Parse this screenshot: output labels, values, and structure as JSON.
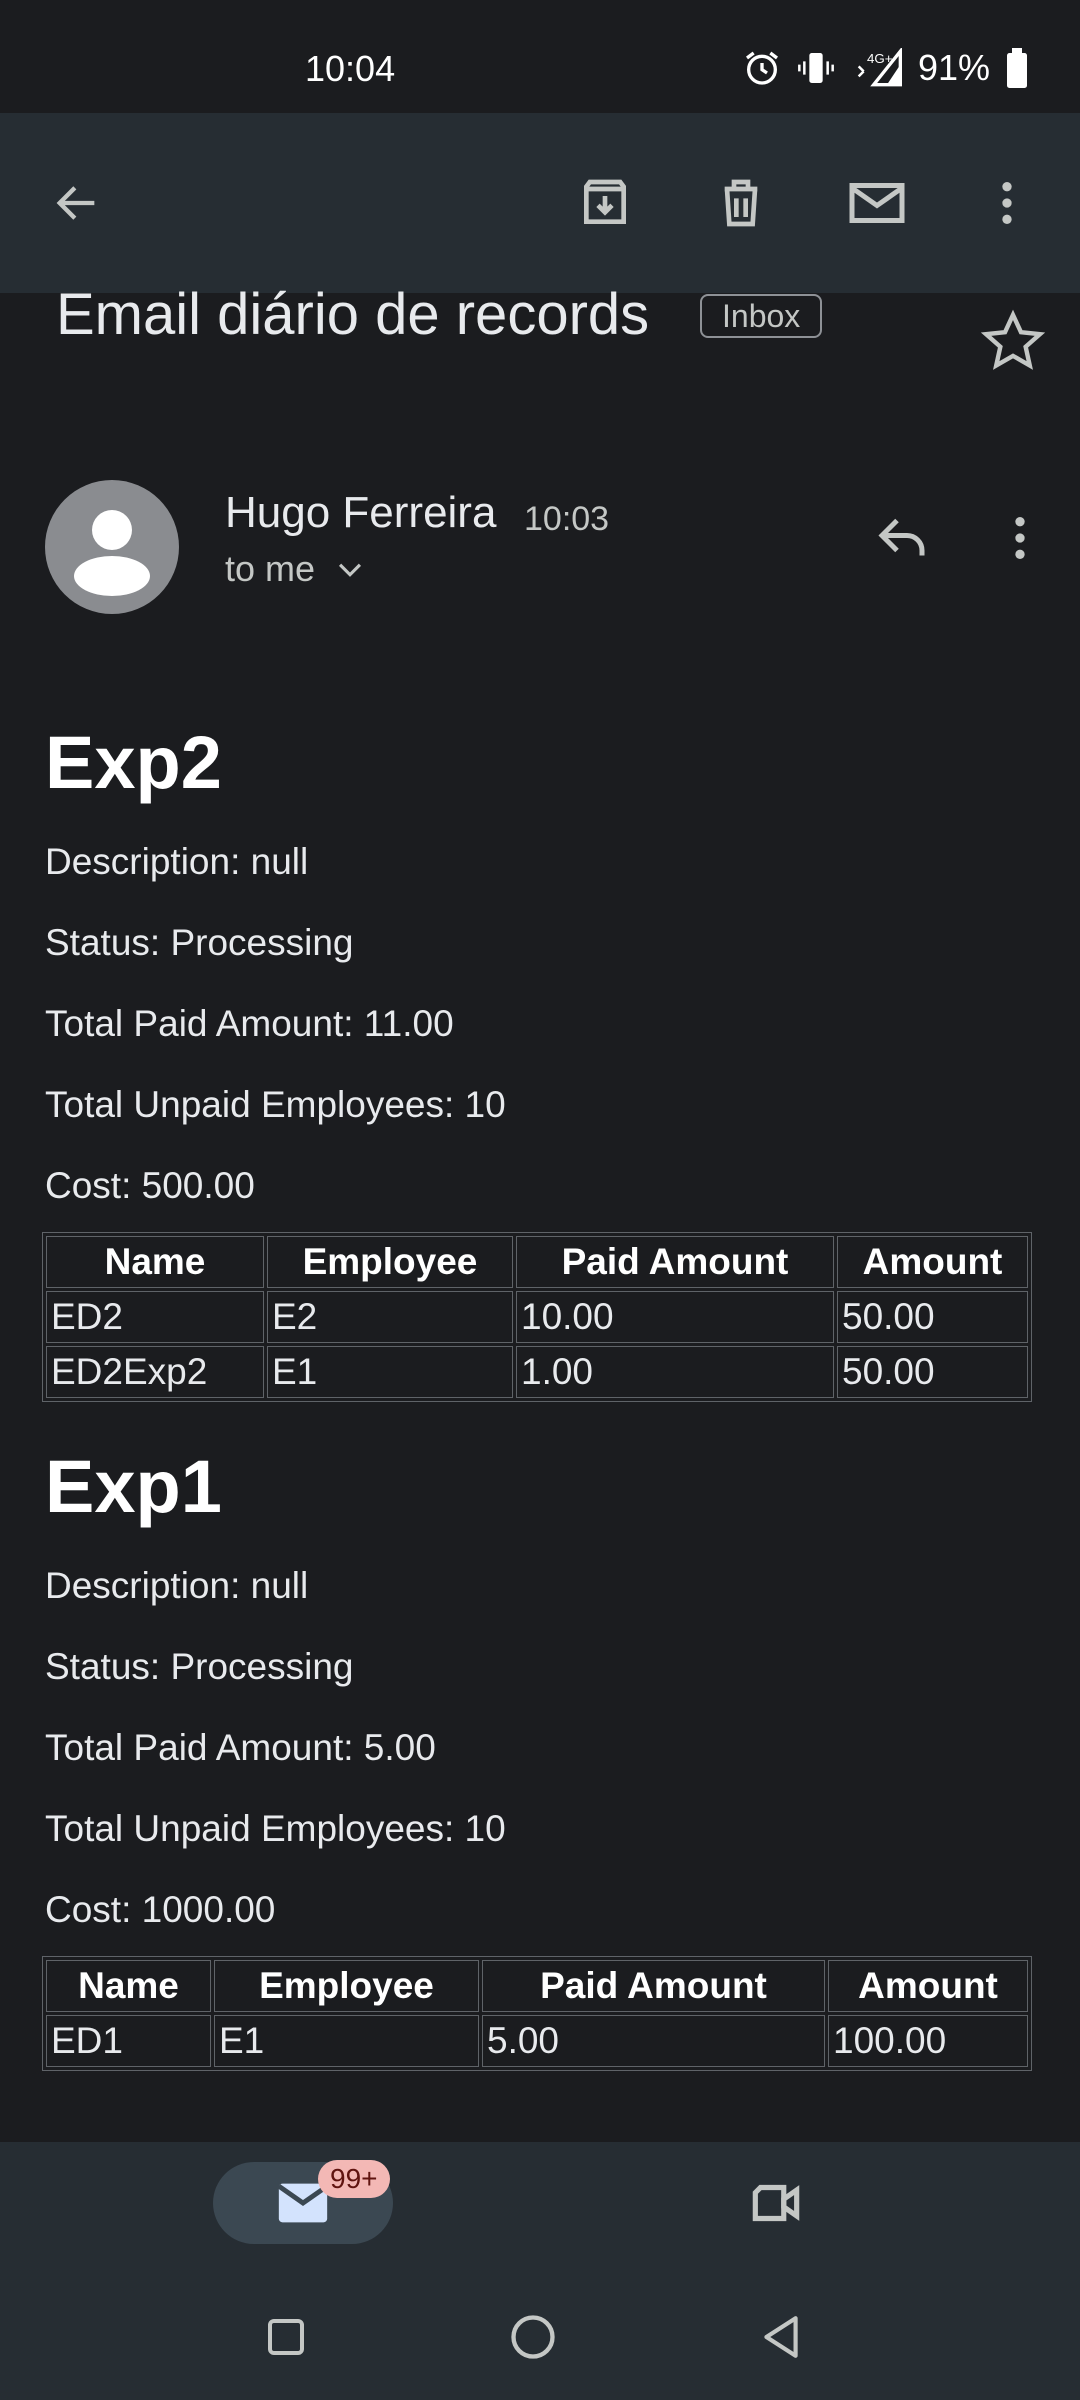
{
  "status_bar": {
    "time": "10:04",
    "network": "4G+",
    "battery": "91%"
  },
  "toolbar": {
    "icons": [
      "back-arrow-icon",
      "archive-icon",
      "delete-icon",
      "mark-unread-icon",
      "more-vert-icon"
    ]
  },
  "email": {
    "subject": "Email diário de records",
    "label": "Inbox",
    "sender": "Hugo Ferreira",
    "time": "10:03",
    "recipient": "to me"
  },
  "experiments": [
    {
      "title": "Exp2",
      "description": "Description: null",
      "status": "Status: Processing",
      "total_paid": "Total Paid Amount: 11.00",
      "unpaid": "Total Unpaid Employees: 10",
      "cost": "Cost: 500.00",
      "headers": [
        "Name",
        "Employee",
        "Paid Amount",
        "Amount"
      ],
      "rows": [
        [
          "ED2",
          "E2",
          "10.00",
          "50.00"
        ],
        [
          "ED2Exp2",
          "E1",
          "1.00",
          "50.00"
        ]
      ]
    },
    {
      "title": "Exp1",
      "description": "Description: null",
      "status": "Status: Processing",
      "total_paid": "Total Paid Amount: 5.00",
      "unpaid": "Total Unpaid Employees: 10",
      "cost": "Cost: 1000.00",
      "headers": [
        "Name",
        "Employee",
        "Paid Amount",
        "Amount"
      ],
      "rows": [
        [
          "ED1",
          "E1",
          "5.00",
          "100.00"
        ]
      ]
    }
  ],
  "bottom_nav": {
    "mail_badge": "99+"
  },
  "colors": {
    "background": "#1b1c1f",
    "toolbar": "#262d33",
    "badge": "#f3b8b5"
  }
}
